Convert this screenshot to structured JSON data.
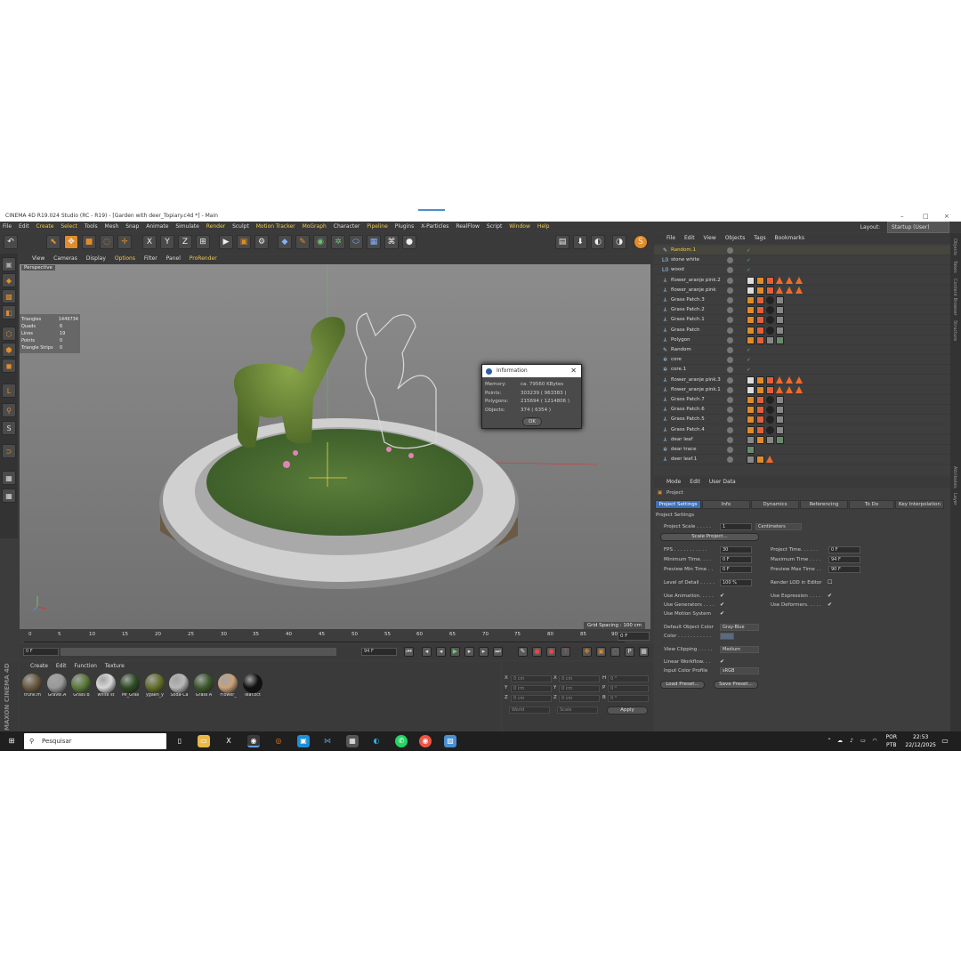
{
  "window": {
    "title": "CINEMA 4D R19.024 Studio (RC - R19) - [Garden with deer_Topiary.c4d *] - Main",
    "minimize": "–",
    "maximize": "□",
    "close": "×"
  },
  "menubar": {
    "items": [
      "File",
      "Edit",
      "Create",
      "Select",
      "Tools",
      "Mesh",
      "Snap",
      "Animate",
      "Simulate",
      "Render",
      "Sculpt",
      "Motion Tracker",
      "MoGraph",
      "Character",
      "Pipeline",
      "Plugins",
      "X-Particles",
      "RealFlow",
      "Script",
      "Window",
      "Help"
    ],
    "layout_label": "Layout:",
    "layout_value": "Startup (User)"
  },
  "viewport": {
    "menu": [
      "View",
      "Cameras",
      "Display",
      "Options",
      "Filter",
      "Panel",
      "ProRender"
    ],
    "label": "Perspective",
    "grid_spacing": "Grid Spacing : 100 cm",
    "stats": [
      {
        "k": "Triangles",
        "v": "1449734"
      },
      {
        "k": "Quads",
        "v": "6"
      },
      {
        "k": "Lines",
        "v": "19"
      },
      {
        "k": "Points",
        "v": "0"
      },
      {
        "k": "Triangle Strips",
        "v": "0"
      }
    ]
  },
  "info_dialog": {
    "title": "Information",
    "close": "✕",
    "rows": [
      {
        "k": "Memory:",
        "v": "ca. 79560 KBytes"
      },
      {
        "k": "Points:",
        "v": "303239 ( 963383 )"
      },
      {
        "k": "Polygons:",
        "v": "215694 ( 1214806 )"
      },
      {
        "k": "Objects:",
        "v": "374 ( 6354 )"
      }
    ],
    "ok": "OK"
  },
  "timeline": {
    "ticks": [
      "0",
      "5",
      "10",
      "15",
      "20",
      "25",
      "30",
      "35",
      "40",
      "45",
      "50",
      "55",
      "60",
      "65",
      "70",
      "75",
      "80",
      "85",
      "90"
    ],
    "current": "0 F",
    "start": "0 F",
    "end": "94 F",
    "max": "94 F"
  },
  "materials": {
    "menu": [
      "Create",
      "Edit",
      "Function",
      "Texture"
    ],
    "items": [
      {
        "name": "trunk.m",
        "color": "#6b5a40"
      },
      {
        "name": "Gravel.A",
        "color": "#9a9a9a"
      },
      {
        "name": "Grass B",
        "color": "#5b7a3a"
      },
      {
        "name": "white st",
        "color": "#d8d8d8"
      },
      {
        "name": "Mf_Gras",
        "color": "#2f4d25"
      },
      {
        "name": "ygaen_y",
        "color": "#65702b"
      },
      {
        "name": "Soda-Ca",
        "color": "#b8b8b8"
      },
      {
        "name": "Grass A",
        "color": "#3d5a2c"
      },
      {
        "name": "Flower_",
        "color": "#c9a27a"
      },
      {
        "name": "leaf.oct",
        "color": "#111111"
      }
    ],
    "brand": "MAXON CINEMA 4D"
  },
  "coords": {
    "x": "X",
    "y": "Y",
    "z": "Z",
    "h": "H",
    "p": "P",
    "b": "B",
    "x_val": "0 cm",
    "y_val": "0 cm",
    "z_val": "0 cm",
    "hx_val": "0 cm",
    "hy_val": "0 cm",
    "hz_val": "0 cm",
    "h_val": "0 °",
    "p_val": "0 °",
    "b_val": "0 °",
    "world": "World",
    "scale": "Scale",
    "apply": "Apply"
  },
  "object_manager": {
    "menu": [
      "File",
      "Edit",
      "View",
      "Objects",
      "Tags",
      "Bookmarks"
    ],
    "objects": [
      {
        "name": "Random.1",
        "icon": "✎",
        "highlight": true
      },
      {
        "name": "stone white",
        "icon": "L0"
      },
      {
        "name": "wood",
        "icon": "L0"
      },
      {
        "name": "flower_aranje pink.2",
        "icon": "⅄"
      },
      {
        "name": "flower_aranje pink",
        "icon": "⅄"
      },
      {
        "name": "Grass Patch.3",
        "icon": "⅄"
      },
      {
        "name": "Grass Patch.2",
        "icon": "⅄"
      },
      {
        "name": "Grass Patch.1",
        "icon": "⅄"
      },
      {
        "name": "Grass Patch",
        "icon": "⅄"
      },
      {
        "name": "Polygon",
        "icon": "⅄"
      },
      {
        "name": "Random",
        "icon": "✎"
      },
      {
        "name": "core",
        "icon": "✲"
      },
      {
        "name": "core.1",
        "icon": "✲"
      },
      {
        "name": "flower_aranje pink.3",
        "icon": "⅄"
      },
      {
        "name": "flower_aranje pink.1",
        "icon": "⅄"
      },
      {
        "name": "Grass Patch.7",
        "icon": "⅄"
      },
      {
        "name": "Grass Patch.6",
        "icon": "⅄"
      },
      {
        "name": "Grass Patch.5",
        "icon": "⅄"
      },
      {
        "name": "Grass Patch.4",
        "icon": "⅄"
      },
      {
        "name": "dear leaf",
        "icon": "⅄"
      },
      {
        "name": "dear trace",
        "icon": "✲"
      },
      {
        "name": "deer leaf.1",
        "icon": "⅄"
      }
    ]
  },
  "attributes": {
    "menu": [
      "Mode",
      "Edit",
      "User Data"
    ],
    "object": "Project",
    "tabs": [
      "Project Settings",
      "Info",
      "Dynamics",
      "Referencing",
      "To Do",
      "Key Interpolation"
    ],
    "section": "Project Settings",
    "project_scale_label": "Project Scale . . . . .",
    "project_scale": "1",
    "project_scale_unit": "Centimeters",
    "scale_project": "Scale Project...",
    "fps_label": "FPS . . . . . . . . . . .",
    "fps": "30",
    "project_time_label": "Project Time. . . . . .",
    "project_time": "0 F",
    "min_time_label": "Minimum Time. . . .",
    "min_time": "0 F",
    "max_time_label": "Maximum Time . . . .",
    "max_time": "94 F",
    "pmin_label": "Preview Min Time . .",
    "pmin": "0 F",
    "pmax_label": "Preview Max Time . .",
    "pmax": "90 F",
    "lod_label": "Level of Detail . . . . .",
    "lod": "100 %",
    "render_lod_label": "Render LOD in Editor",
    "use_anim_label": "Use Animation. . . . .",
    "use_expr_label": "Use Expression . . . .",
    "use_gen_label": "Use Generators . . . .",
    "use_def_label": "Use Deformers. . . . .",
    "use_mo_label": "Use Motion System",
    "doc_label": "Default Object Color",
    "doc": "Gray-Blue",
    "color_label": "Color . . . . . . . . . . .",
    "clip_label": "View Clipping . . . . .",
    "clip": "Medium",
    "lw_label": "Linear Workflow. . .",
    "icp_label": "Input Color Profile",
    "icp": "sRGB",
    "load_preset": "Load Preset...",
    "save_preset": "Save Preset...",
    "check": "✔"
  },
  "right_strip": [
    "Objects",
    "Takes",
    "Content Browser",
    "Structure",
    "Attributes",
    "Layer"
  ],
  "taskbar": {
    "search_placeholder": "Pesquisar",
    "lang1": "POR",
    "lang2": "PTB",
    "time": "22:53",
    "date": "22/12/2025"
  }
}
